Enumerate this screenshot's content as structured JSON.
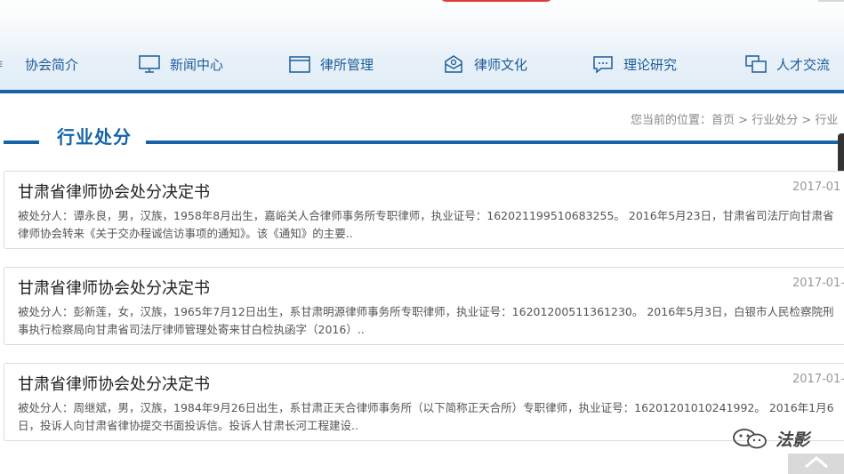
{
  "header": {
    "nav": [
      {
        "label": "协会简介",
        "icon": "list-icon"
      },
      {
        "label": "新闻中心",
        "icon": "monitor-icon"
      },
      {
        "label": "律所管理",
        "icon": "folder-icon"
      },
      {
        "label": "律师文化",
        "icon": "book-icon"
      },
      {
        "label": "理论研究",
        "icon": "chat-icon"
      },
      {
        "label": "人才交流",
        "icon": "exchange-icon"
      }
    ],
    "accent_color": "#1563a8"
  },
  "section": {
    "title": "行业处分"
  },
  "breadcrumb": {
    "prefix": "您当前的位置：",
    "items": [
      "首页",
      "行业处分",
      "行业"
    ],
    "separator": ">"
  },
  "articles": [
    {
      "title": "甘肃省律师协会处分决定书",
      "date": "2017-01",
      "summary": "被处分人：谭永良，男，汉族，1958年8月出生，嘉峪关人合律师事务所专职律师，执业证号：16202119951068325​5。 2016年5月23日，甘肃省司法厅向甘肃省律师协会转来《关于交办程诚信访事项的通知》。该《通知》的主要.."
    },
    {
      "title": "甘肃省律师协会处分决定书",
      "date": "2017-01-",
      "summary": "被处分人：彭新莲，女，汉族，1965年7月12日出生，系甘肃明源律师事务所专职律师，执业证号：16201200511361230。 2016年5月3日，白银市人民检察院刑事执行检察局向甘肃省司法厅律师管理处寄来甘白检执函字（2016）.."
    },
    {
      "title": "甘肃省律师协会处分决定书",
      "date": "2017-01-",
      "summary": "被处分人：周继斌，男，汉族，1984年9月26日出生，系甘肃正天合律师事务所（以下简称正天合所）专职律师，执业证号：16201201010241992。 2016年1月6日，投诉人向甘肃省律协提交书面投诉信。投诉人甘肃长河工程建设.."
    }
  ],
  "watermark": {
    "text": "法影",
    "icon": "wechat-icon"
  },
  "back_to_top": {
    "icon": "chevron-up-icon"
  }
}
